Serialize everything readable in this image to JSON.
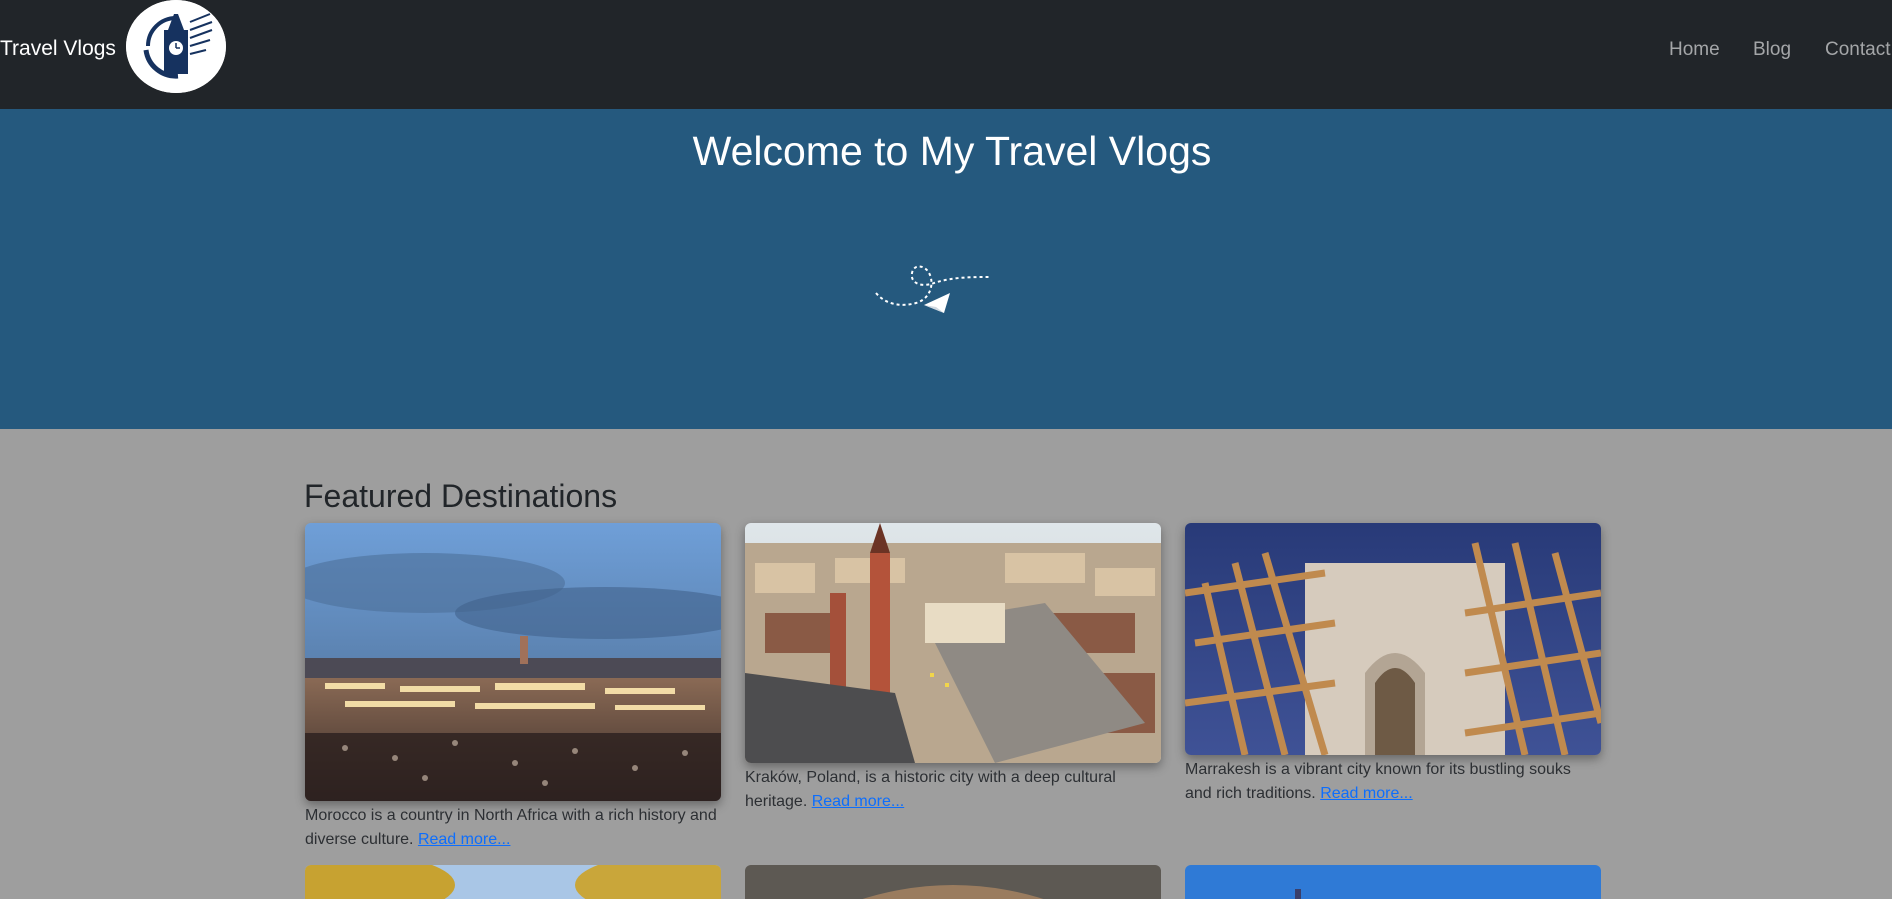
{
  "navbar": {
    "brand": "Travel Vlogs",
    "logo_icon": "clock-tower-globe-logo",
    "links": [
      {
        "label": "Home"
      },
      {
        "label": "Blog"
      },
      {
        "label": "Contact"
      }
    ]
  },
  "hero": {
    "title": "Welcome to My Travel Vlogs",
    "icon": "paper-plane-icon"
  },
  "featured": {
    "title": "Featured Destinations",
    "cards": [
      {
        "image": "marrakesh-square-at-dusk",
        "text": "Morocco is a country in North Africa with a rich history and diverse culture.",
        "link": "Read more..."
      },
      {
        "image": "krakow-old-town-aerial",
        "text": "Kraków, Poland, is a historic city with a deep cultural heritage.",
        "link": "Read more..."
      },
      {
        "image": "marrakesh-wooden-scaffolding",
        "text": "Marrakesh is a vibrant city known for its bustling souks and rich traditions.",
        "link": "Read more..."
      }
    ]
  },
  "colors": {
    "navbar_bg": "#212529",
    "hero_bg": "#25597e",
    "page_bg": "#9e9e9e",
    "link": "#0d6efd",
    "nav_link": "#a4a6a8"
  }
}
